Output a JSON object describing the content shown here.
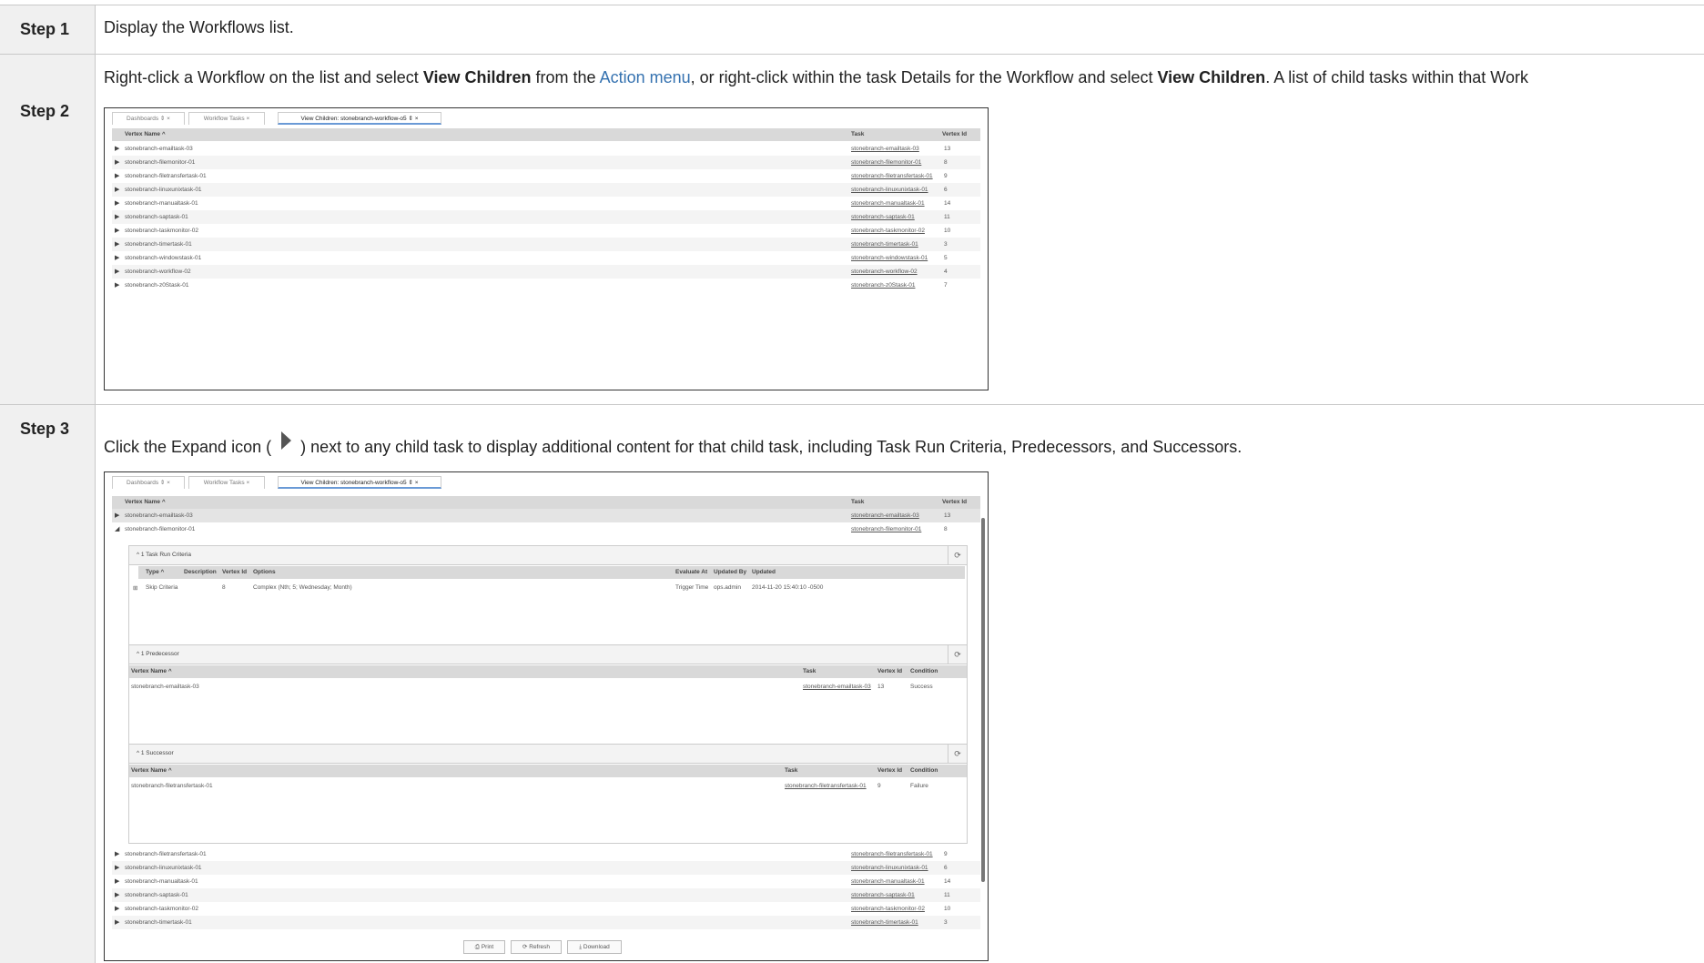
{
  "steps": [
    {
      "label": "Step 1",
      "text": "Display the Workflows list."
    },
    {
      "label": "Step 2",
      "text_a": "Right-click a Workflow on the list and select ",
      "bold_a": "View Children",
      "text_b": " from the ",
      "link": "Action menu",
      "text_c": ", or right-click within the task Details for the Workflow and select ",
      "bold_b": "View Children",
      "text_d": ". A list of child tasks within that Work"
    },
    {
      "label": "Step 3",
      "text_a": "Click the Expand icon ( ",
      "text_b": " ) next to any child task to display additional content for that child task, including Task Run Criteria, Predecessors, and Successors.",
      "expand_icon": "expand-arrow-icon"
    }
  ],
  "shot1": {
    "tabs": [
      "Dashboards ⇕ ×",
      "Workflow Tasks ×",
      "View Children: stonebranch-workflow-o5 ⇕ ×"
    ],
    "headers": [
      "Vertex Name ^",
      "Task",
      "Vertex Id"
    ],
    "rows": [
      {
        "name": "stonebranch-emailtask-03",
        "task": "stonebranch-emailtask-03",
        "id": "13"
      },
      {
        "name": "stonebranch-filemonitor-01",
        "task": "stonebranch-filemonitor-01",
        "id": "8"
      },
      {
        "name": "stonebranch-filetransfertask-01",
        "task": "stonebranch-filetransfertask-01",
        "id": "9"
      },
      {
        "name": "stonebranch-linuxunixtask-01",
        "task": "stonebranch-linuxunixtask-01",
        "id": "6"
      },
      {
        "name": "stonebranch-manualtask-01",
        "task": "stonebranch-manualtask-01",
        "id": "14"
      },
      {
        "name": "stonebranch-saptask-01",
        "task": "stonebranch-saptask-01",
        "id": "11"
      },
      {
        "name": "stonebranch-taskmonitor-02",
        "task": "stonebranch-taskmonitor-02",
        "id": "10"
      },
      {
        "name": "stonebranch-timertask-01",
        "task": "stonebranch-timertask-01",
        "id": "3"
      },
      {
        "name": "stonebranch-windowstask-01",
        "task": "stonebranch-windowstask-01",
        "id": "5"
      },
      {
        "name": "stonebranch-workflow-02",
        "task": "stonebranch-workflow-02",
        "id": "4"
      },
      {
        "name": "stonebranch-z0Stask-01",
        "task": "stonebranch-z0Stask-01",
        "id": "7"
      }
    ]
  },
  "shot2": {
    "tabs": [
      "Dashboards ⇕ ×",
      "Workflow Tasks ×",
      "View Children: stonebranch-workflow-o5 ⇕ ×"
    ],
    "headers": [
      "Vertex Name ^",
      "Task",
      "Vertex Id"
    ],
    "top_rows": [
      {
        "name": "stonebranch-emailtask-03",
        "task": "stonebranch-emailtask-03",
        "id": "13"
      },
      {
        "name": "stonebranch-filemonitor-01",
        "task": "stonebranch-filemonitor-01",
        "id": "8"
      }
    ],
    "criteria": {
      "title": "^ 1 Task Run Criteria",
      "headers": [
        "Type ^",
        "Description",
        "Vertex Id",
        "Options",
        "Evaluate At",
        "Updated By",
        "Updated"
      ],
      "row": {
        "type": "Skip Criteria",
        "vid": "8",
        "options": "Complex (Nth; 5; Wednesday; Month)",
        "eval": "Trigger Time",
        "by": "ops.admin",
        "updated": "2014-11-20 15:40:10 -0500"
      }
    },
    "predecessor": {
      "title": "^ 1 Predecessor",
      "headers": [
        "Vertex Name ^",
        "Task",
        "Vertex Id",
        "Condition"
      ],
      "row": {
        "name": "stonebranch-emailtask-03",
        "task": "stonebranch-emailtask-03",
        "id": "13",
        "cond": "Success"
      }
    },
    "successor": {
      "title": "^ 1 Successor",
      "headers": [
        "Vertex Name ^",
        "Task",
        "Vertex Id",
        "Condition"
      ],
      "row": {
        "name": "stonebranch-filetransfertask-01",
        "task": "stonebranch-filetransfertask-01",
        "id": "9",
        "cond": "Failure"
      }
    },
    "bottom_rows": [
      {
        "name": "stonebranch-filetransfertask-01",
        "task": "stonebranch-filetransfertask-01",
        "id": "9"
      },
      {
        "name": "stonebranch-linuxunixtask-01",
        "task": "stonebranch-linuxunixtask-01",
        "id": "6"
      },
      {
        "name": "stonebranch-manualtask-01",
        "task": "stonebranch-manualtask-01",
        "id": "14"
      },
      {
        "name": "stonebranch-saptask-01",
        "task": "stonebranch-saptask-01",
        "id": "11"
      },
      {
        "name": "stonebranch-taskmonitor-02",
        "task": "stonebranch-taskmonitor-02",
        "id": "10"
      },
      {
        "name": "stonebranch-timertask-01",
        "task": "stonebranch-timertask-01",
        "id": "3"
      }
    ],
    "buttons": [
      "Print",
      "Refresh",
      "Download"
    ],
    "button_icons": [
      "print-icon",
      "refresh-icon",
      "download-icon"
    ]
  }
}
